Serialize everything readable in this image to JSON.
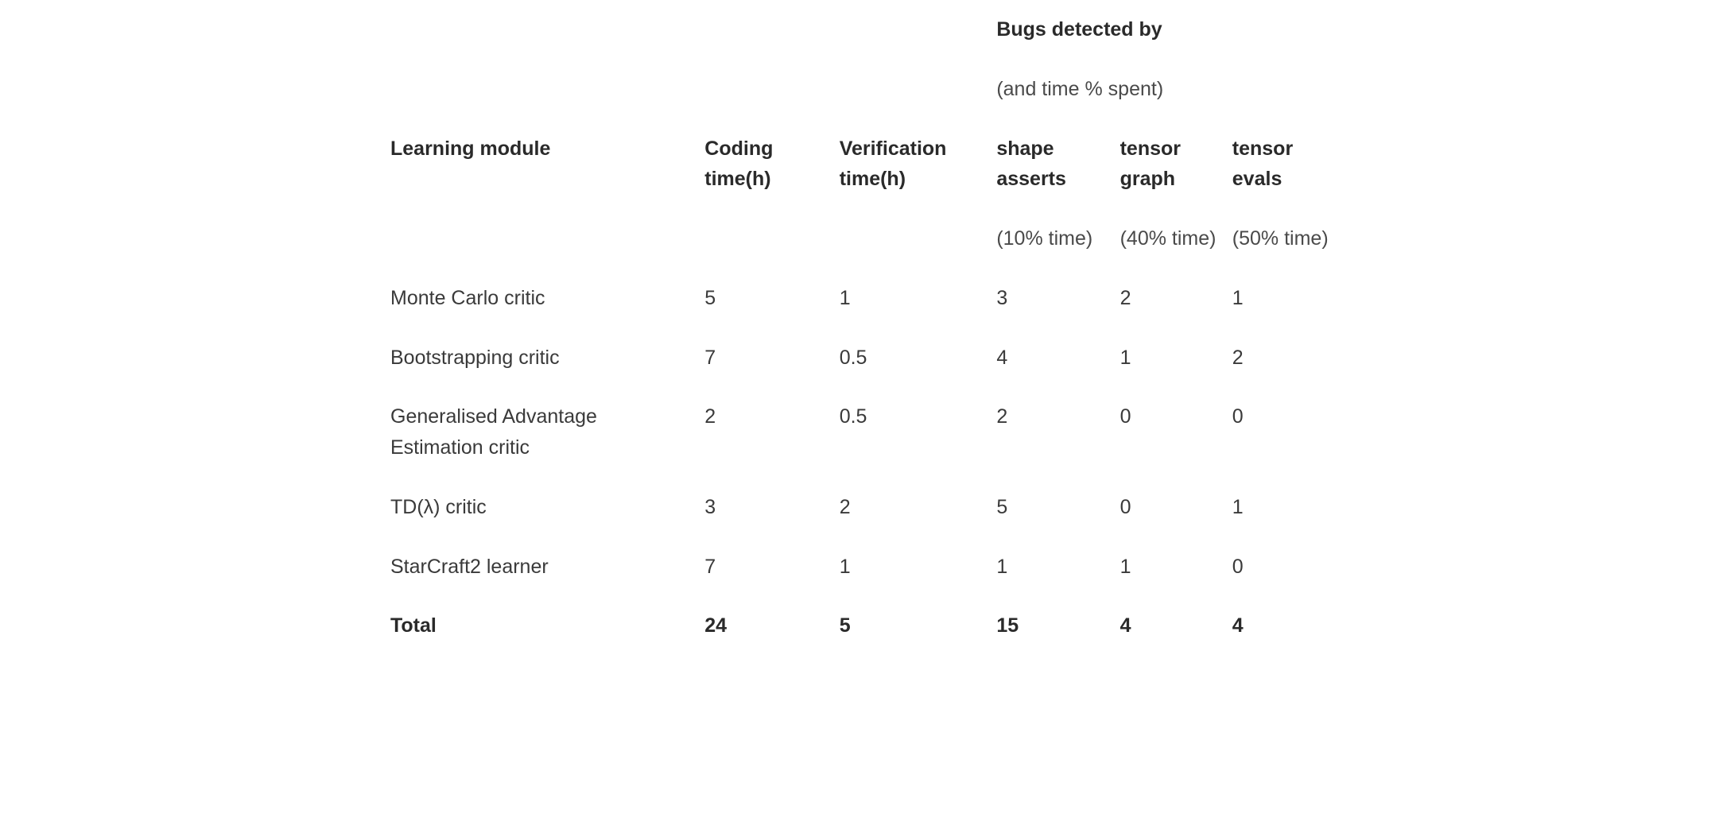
{
  "chart_data": {
    "type": "table",
    "columns": [
      "Learning module",
      "Coding time(h)",
      "Verification time(h)",
      "shape asserts",
      "tensor graph",
      "tensor evals"
    ],
    "bugs_header": "Bugs detected by",
    "bugs_subheader": "(and time % spent)",
    "time_percents": [
      "(10% time)",
      "(40% time)",
      "(50% time)"
    ],
    "rows": [
      {
        "module": "Monte Carlo critic",
        "coding": "5",
        "verif": "1",
        "shape": "3",
        "graph": "2",
        "evals": "1"
      },
      {
        "module": "Bootstrapping critic",
        "coding": "7",
        "verif": "0.5",
        "shape": "4",
        "graph": "1",
        "evals": "2"
      },
      {
        "module": "Generalised Advantage Estimation critic",
        "coding": "2",
        "verif": "0.5",
        "shape": "2",
        "graph": "0",
        "evals": "0"
      },
      {
        "module": "TD(λ) critic",
        "coding": "3",
        "verif": "2",
        "shape": "5",
        "graph": "0",
        "evals": "1"
      },
      {
        "module": "StarCraft2 learner",
        "coding": "7",
        "verif": "1",
        "shape": "1",
        "graph": "1",
        "evals": "0"
      }
    ],
    "total": {
      "module": "Total",
      "coding": "24",
      "verif": "5",
      "shape": "15",
      "graph": "4",
      "evals": "4"
    }
  }
}
